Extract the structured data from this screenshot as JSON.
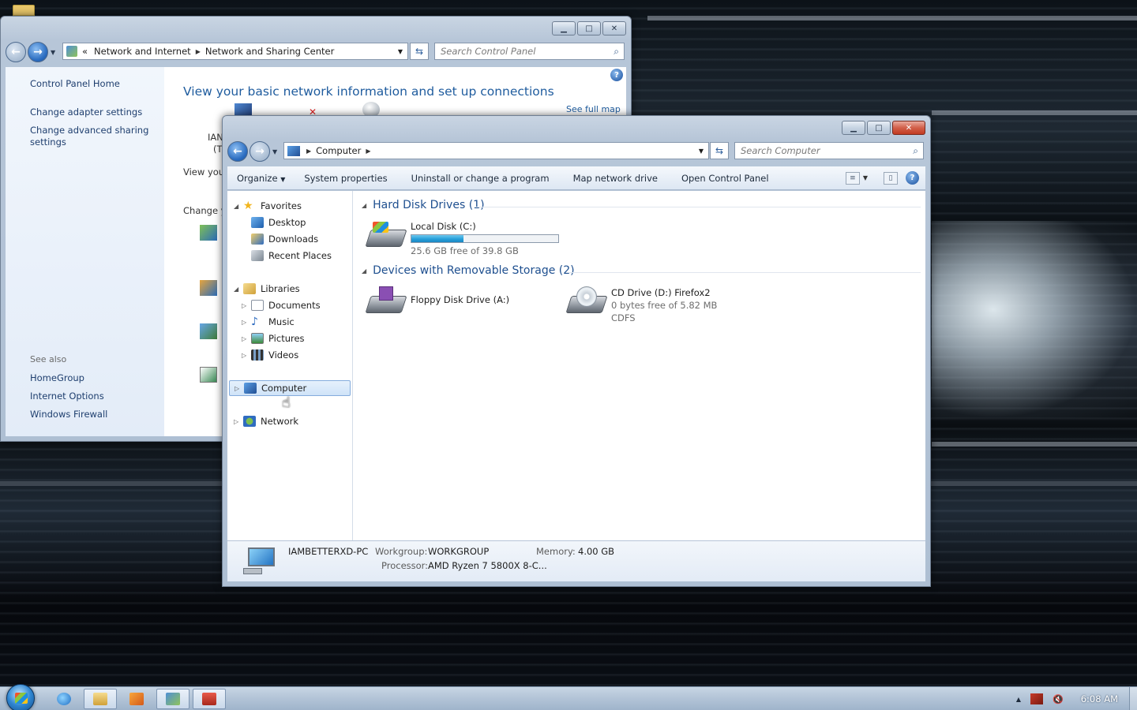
{
  "colors": {
    "link_blue": "#1f5c9e",
    "group_header": "#1e4f8f",
    "capacity_fill": "#26a0da",
    "close_red": "#c23b22"
  },
  "control_panel": {
    "address": {
      "overflow": "«",
      "crumbs": [
        "Network and Internet",
        "Network and Sharing Center"
      ]
    },
    "search_placeholder": "Search Control Panel",
    "left_links": {
      "home": "Control Panel Home",
      "adapter": "Change adapter settings",
      "advanced_sharing_1": "Change advanced sharing",
      "advanced_sharing_2": "settings"
    },
    "see_also": {
      "heading": "See also",
      "items": [
        "HomeGroup",
        "Internet Options",
        "Windows Firewall"
      ]
    },
    "main_title": "View your basic network information and set up connections",
    "see_full_map": "See full map",
    "fragments": {
      "iam": "IAN",
      "t": "(T",
      "view_you": "View you",
      "change_y": "Change y"
    }
  },
  "computer": {
    "address": {
      "crumb": "Computer"
    },
    "search_placeholder": "Search Computer",
    "toolbar": {
      "organize": "Organize",
      "system_properties": "System properties",
      "uninstall": "Uninstall or change a program",
      "map_drive": "Map network drive",
      "open_cp": "Open Control Panel"
    },
    "nav": {
      "favorites": "Favorites",
      "desktop": "Desktop",
      "downloads": "Downloads",
      "recent": "Recent Places",
      "libraries": "Libraries",
      "documents": "Documents",
      "music": "Music",
      "pictures": "Pictures",
      "videos": "Videos",
      "computer": "Computer",
      "network": "Network"
    },
    "groups": {
      "hdd": "Hard Disk Drives (1)",
      "removable": "Devices with Removable Storage (2)"
    },
    "drives": {
      "c": {
        "name": "Local Disk (C:)",
        "free": "25.6 GB free of 39.8 GB",
        "used_fraction": 0.357
      },
      "a": {
        "name": "Floppy Disk Drive (A:)"
      },
      "d": {
        "name": "CD Drive (D:) Firefox2",
        "free": "0 bytes free of 5.82 MB",
        "fs": "CDFS"
      }
    },
    "details": {
      "pc_name": "IAMBETTERXD-PC",
      "workgroup_label": "Workgroup:",
      "workgroup": "WORKGROUP",
      "memory_label": "Memory:",
      "memory": "4.00 GB",
      "processor_label": "Processor:",
      "processor": "AMD Ryzen 7 5800X 8-C..."
    }
  },
  "taskbar": {
    "clock": "6:08 AM",
    "tray_up": "▲"
  }
}
